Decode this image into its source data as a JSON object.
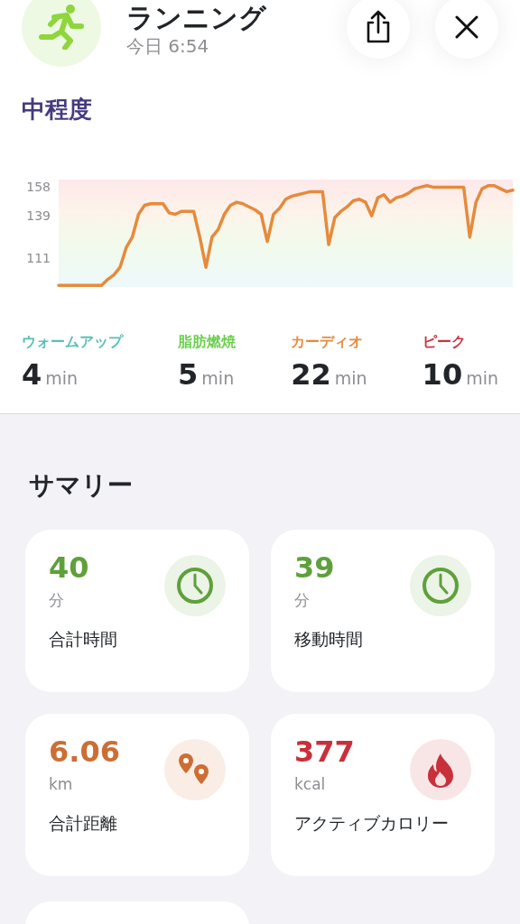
{
  "header": {
    "title": "ランニング",
    "subtitle": "今日 6:54"
  },
  "intensity": "中程度",
  "heart_rate": {
    "chart_data": {
      "type": "line",
      "ylim": [
        92,
        163
      ],
      "yticks": [
        111,
        139,
        158
      ],
      "categories": [
        null,
        null,
        null,
        null,
        null,
        null,
        null,
        null,
        null,
        null,
        null,
        null,
        null,
        null,
        null,
        null,
        null,
        null,
        null,
        null,
        null,
        null,
        null,
        null,
        null,
        null,
        null,
        null,
        null,
        null,
        null,
        null,
        null,
        null,
        null,
        null,
        null,
        null,
        null,
        null,
        null,
        null,
        null,
        null,
        null,
        null,
        null,
        null,
        null,
        null,
        null,
        null,
        null,
        null,
        null,
        null,
        null,
        null,
        null,
        null,
        null,
        null,
        null,
        null,
        null,
        null,
        null,
        null,
        null,
        null,
        null,
        null,
        null,
        null,
        null
      ],
      "series": [
        {
          "color": "#e68a3c",
          "values": [
            93,
            93,
            93,
            93,
            93,
            93,
            93,
            93,
            97,
            100,
            105,
            118,
            125,
            140,
            146,
            147,
            147,
            147,
            141,
            140,
            142,
            142,
            142,
            125,
            105,
            125,
            130,
            140,
            146,
            148,
            147,
            145,
            143,
            140,
            122,
            140,
            144,
            150,
            152,
            153,
            154,
            155,
            155,
            155,
            120,
            138,
            142,
            145,
            149,
            150,
            148,
            139,
            151,
            153,
            148,
            151,
            152,
            154,
            157,
            158,
            159,
            158,
            158,
            158,
            158,
            158,
            158,
            125,
            148,
            157,
            159,
            159,
            157,
            155,
            156
          ]
        }
      ]
    }
  },
  "zones": [
    {
      "label": "ウォームアップ",
      "value": "4",
      "unit": "min",
      "color": "#5bbfb5"
    },
    {
      "label": "脂肪燃焼",
      "value": "5",
      "unit": "min",
      "color": "#6ccf4f"
    },
    {
      "label": "カーディオ",
      "value": "22",
      "unit": "min",
      "color": "#e68a3c"
    },
    {
      "label": "ピーク",
      "value": "10",
      "unit": "min",
      "color": "#cc3340"
    }
  ],
  "summary": {
    "title": "サマリー",
    "cards": [
      {
        "value": "40",
        "unit": "分",
        "label": "合計時間",
        "color": "#5fa03c",
        "kind": "clock"
      },
      {
        "value": "39",
        "unit": "分",
        "label": "移動時間",
        "color": "#5fa03c",
        "kind": "clock"
      },
      {
        "value": "6.06",
        "unit": "km",
        "label": "合計距離",
        "color": "#cc6e34",
        "kind": "pins"
      },
      {
        "value": "377",
        "unit": "kcal",
        "label": "アクティブカロリー",
        "color": "#c8303a",
        "kind": "flame"
      }
    ]
  }
}
